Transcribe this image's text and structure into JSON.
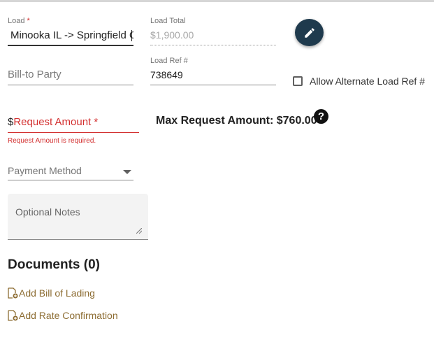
{
  "load": {
    "label": "Load",
    "required_mark": "*",
    "value": "Minooka IL -> Springfield OH"
  },
  "load_total": {
    "label": "Load Total",
    "value": "$1,900.00"
  },
  "edit_button": {
    "icon": "pencil-icon"
  },
  "bill_to": {
    "placeholder": "Bill-to Party"
  },
  "load_ref": {
    "label": "Load Ref #",
    "value": "738649"
  },
  "alt_load_ref": {
    "label": "Allow Alternate Load Ref #",
    "checked": false
  },
  "request_amount": {
    "prefix": "$",
    "label": "Request Amount *",
    "error": "Request Amount is required.",
    "error_color": "#d32f2f"
  },
  "max_request": {
    "text": "Max Request Amount: $760.00",
    "help_icon": "help-icon",
    "help_glyph": "?"
  },
  "payment_method": {
    "label": "Payment Method"
  },
  "notes": {
    "placeholder": "Optional Notes"
  },
  "documents": {
    "title": "Documents (0)",
    "links": [
      {
        "label": "Add Bill of Lading",
        "icon": "file-add-icon"
      },
      {
        "label": "Add Rate Confirmation",
        "icon": "file-add-icon"
      }
    ],
    "link_color": "#8d6d33"
  },
  "colors": {
    "primary_fab": "#1f3a4d",
    "error": "#d32f2f",
    "link": "#8d6d33"
  }
}
